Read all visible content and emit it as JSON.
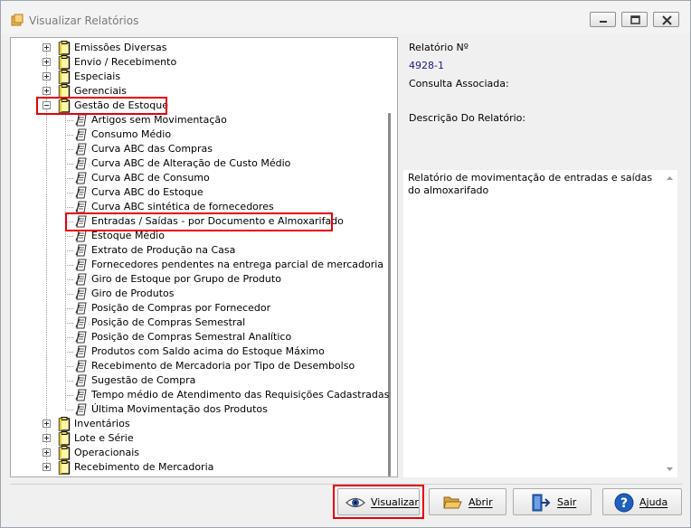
{
  "window": {
    "title": "Visualizar Relatórios",
    "min_icon": "minimize-icon",
    "max_icon": "maximize-icon",
    "close_icon": "close-icon"
  },
  "tree": {
    "top_level_before": [
      "Emissões Diversas",
      "Envio / Recebimento",
      "Especiais",
      "Gerenciais"
    ],
    "expanded_group": "Gestão de Estoque",
    "children": [
      "Artigos sem Movimentação",
      "Consumo Médio",
      "Curva ABC das Compras",
      "Curva ABC de Alteração de Custo Médio",
      "Curva ABC de Consumo",
      "Curva ABC do Estoque",
      "Curva ABC sintética de fornecedores",
      "Entradas / Saídas - por Documento e Almoxarifado",
      "Estoque Médio",
      "Extrato de Produção na Casa",
      "Fornecedores pendentes na entrega parcial de mercadoria",
      "Giro de Estoque por Grupo de Produto",
      "Giro de Produtos",
      "Posição de Compras por Fornecedor",
      "Posição de Compras Semestral",
      "Posição de Compras Semestral Analítico",
      "Produtos com Saldo acima do Estoque Máximo",
      "Recebimento de Mercadoria por Tipo de Desembolso",
      "Sugestão de Compra",
      "Tempo médio de Atendimento das Requisições Cadastradas",
      "Última Movimentação dos Produtos"
    ],
    "selected_child_index": 7,
    "top_level_after": [
      "Inventários",
      "Lote e Série",
      "Operacionais",
      "Recebimento de Mercadoria"
    ]
  },
  "info": {
    "report_number_label": "Relatório Nº",
    "report_number": "4928-1",
    "associated_query_label": "Consulta Associada:",
    "associated_query": "",
    "description_label": "Descrição Do Relatório:",
    "description": "Relatório de movimentação de entradas e saídas do almoxarifado"
  },
  "buttons": {
    "view": "Visualizar",
    "open": "Abrir",
    "exit": "Sair",
    "help": "Ajuda"
  },
  "colors": {
    "highlight": "#e8000b",
    "value_text": "#1a1a8a"
  }
}
